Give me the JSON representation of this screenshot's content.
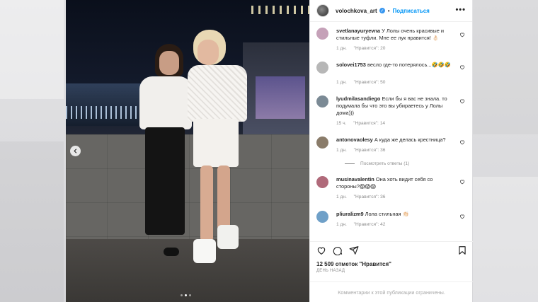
{
  "post": {
    "username": "volochkova_art",
    "separator": "•",
    "follow_label": "Подписаться",
    "more_label": "•••",
    "carousel": {
      "total": 3,
      "active": 2
    }
  },
  "comments": [
    {
      "user": "svetlanayuryevna",
      "text": "У Лолы очень красивые и стильные туфли. Мне ее лук нравится! 👌🏻",
      "age": "1 дн.",
      "likes": "\"Нравится\": 20",
      "avatar_color": "#c5a1b8"
    },
    {
      "user": "solovei1753",
      "text": "весло где-то потерялось...🤣🤣🤣",
      "age": "1 дн.",
      "likes": "\"Нравится\": 50",
      "avatar_color": "#b7b7b7"
    },
    {
      "user": "lyudmilasandiego",
      "text": "Если бы я вас не знала. то подумала бы что это вы убираетесь у Лолы дома)))",
      "age": "15 ч.",
      "likes": "\"Нравится\": 14",
      "avatar_color": "#7b8a95"
    },
    {
      "user": "antonovaolesy",
      "text": "А куда же делась крестница?",
      "age": "1 дн.",
      "likes": "\"Нравится\": 36",
      "avatar_color": "#8a7c6a",
      "replies": "Посмотреть ответы (1)"
    },
    {
      "user": "musinavalentin",
      "text": "Она хоть видит себя со стороны?😱😱😱",
      "age": "1 дн.",
      "likes": "\"Нравится\": 36",
      "avatar_color": "#b06a7a"
    },
    {
      "user": "pliuralizm9",
      "text": "Лола стильная 👏🏻",
      "age": "1 дн.",
      "likes": "\"Нравится\": 42",
      "avatar_color": "#6fa0c8"
    }
  ],
  "stats": {
    "likes": "12 509 отметок \"Нравится\"",
    "time": "ДЕНЬ НАЗАД"
  },
  "comments_disabled": "Комментарии к этой публикации ограничены.",
  "colors": {
    "accent": "#0095f6",
    "verified": "#3897f0",
    "muted": "#8e8e8e"
  }
}
